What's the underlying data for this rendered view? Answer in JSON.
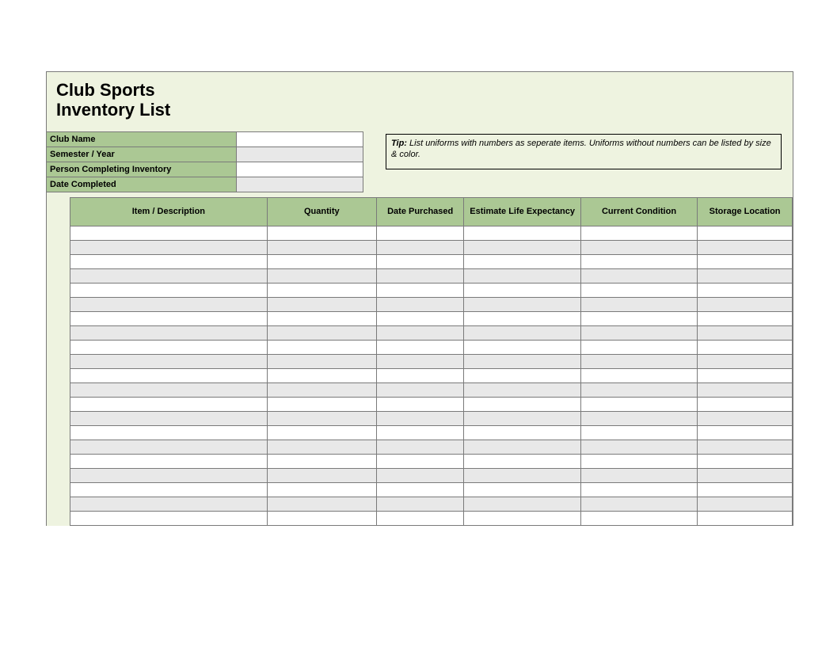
{
  "title": {
    "line1": "Club Sports",
    "line2": "Inventory List"
  },
  "meta_fields": [
    {
      "label": "Club Name",
      "value": "",
      "shade": "w"
    },
    {
      "label": "Semester / Year",
      "value": "",
      "shade": "g"
    },
    {
      "label": "Person Completing Inventory",
      "value": "",
      "shade": "w"
    },
    {
      "label": "Date Completed",
      "value": "",
      "shade": "g"
    }
  ],
  "tip": {
    "label": "Tip:",
    "text": " List uniforms with numbers as seperate items. Uniforms without numbers can be listed by size & color."
  },
  "columns": [
    "Item / Description",
    "Quantity",
    "Date Purchased",
    "Estimate Life Expectancy",
    "Current Condition",
    "Storage Location"
  ],
  "rows": [
    {
      "desc": "",
      "qty": "",
      "date": "",
      "life": "",
      "cond": "",
      "stor": ""
    },
    {
      "desc": "",
      "qty": "",
      "date": "",
      "life": "",
      "cond": "",
      "stor": ""
    },
    {
      "desc": "",
      "qty": "",
      "date": "",
      "life": "",
      "cond": "",
      "stor": ""
    },
    {
      "desc": "",
      "qty": "",
      "date": "",
      "life": "",
      "cond": "",
      "stor": ""
    },
    {
      "desc": "",
      "qty": "",
      "date": "",
      "life": "",
      "cond": "",
      "stor": ""
    },
    {
      "desc": "",
      "qty": "",
      "date": "",
      "life": "",
      "cond": "",
      "stor": ""
    },
    {
      "desc": "",
      "qty": "",
      "date": "",
      "life": "",
      "cond": "",
      "stor": ""
    },
    {
      "desc": "",
      "qty": "",
      "date": "",
      "life": "",
      "cond": "",
      "stor": ""
    },
    {
      "desc": "",
      "qty": "",
      "date": "",
      "life": "",
      "cond": "",
      "stor": ""
    },
    {
      "desc": "",
      "qty": "",
      "date": "",
      "life": "",
      "cond": "",
      "stor": ""
    },
    {
      "desc": "",
      "qty": "",
      "date": "",
      "life": "",
      "cond": "",
      "stor": ""
    },
    {
      "desc": "",
      "qty": "",
      "date": "",
      "life": "",
      "cond": "",
      "stor": ""
    },
    {
      "desc": "",
      "qty": "",
      "date": "",
      "life": "",
      "cond": "",
      "stor": ""
    },
    {
      "desc": "",
      "qty": "",
      "date": "",
      "life": "",
      "cond": "",
      "stor": ""
    },
    {
      "desc": "",
      "qty": "",
      "date": "",
      "life": "",
      "cond": "",
      "stor": ""
    },
    {
      "desc": "",
      "qty": "",
      "date": "",
      "life": "",
      "cond": "",
      "stor": ""
    },
    {
      "desc": "",
      "qty": "",
      "date": "",
      "life": "",
      "cond": "",
      "stor": ""
    },
    {
      "desc": "",
      "qty": "",
      "date": "",
      "life": "",
      "cond": "",
      "stor": ""
    },
    {
      "desc": "",
      "qty": "",
      "date": "",
      "life": "",
      "cond": "",
      "stor": ""
    },
    {
      "desc": "",
      "qty": "",
      "date": "",
      "life": "",
      "cond": "",
      "stor": ""
    },
    {
      "desc": "",
      "qty": "",
      "date": "",
      "life": "",
      "cond": "",
      "stor": ""
    }
  ]
}
